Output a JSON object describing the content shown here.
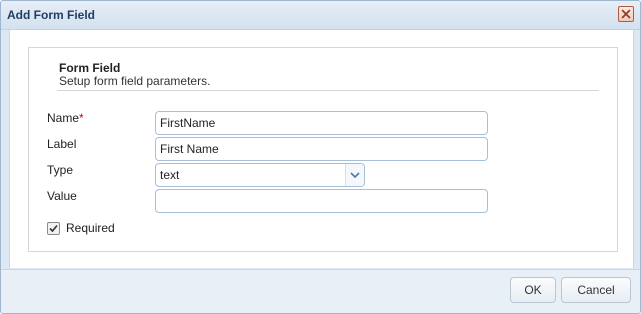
{
  "dialog": {
    "title": "Add Form Field",
    "close_icon": "close-icon"
  },
  "section": {
    "title": "Form Field",
    "description": "Setup form field parameters."
  },
  "fields": {
    "name": {
      "label": "Name",
      "required_mark": "*",
      "value": "FirstName"
    },
    "label": {
      "label": "Label",
      "value": "First Name"
    },
    "type": {
      "label": "Type",
      "selected": "text",
      "arrow_icon": "chevron-down-icon"
    },
    "value": {
      "label": "Value",
      "value": ""
    }
  },
  "required_checkbox": {
    "label": "Required",
    "checked": true
  },
  "footer": {
    "ok_label": "OK",
    "cancel_label": "Cancel"
  },
  "colors": {
    "titlebar": "#d4e1ef",
    "title_text": "#1f3f63",
    "input_border": "#a7bfd8",
    "required_star": "#d40000"
  }
}
